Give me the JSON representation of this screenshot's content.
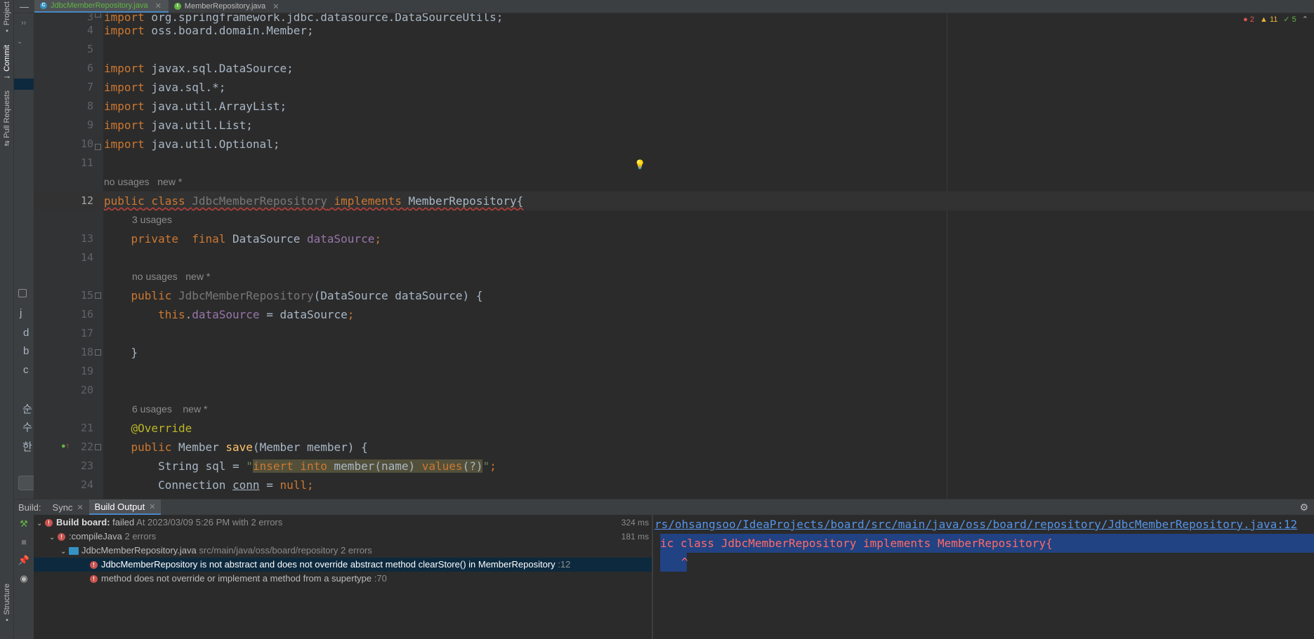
{
  "left_strip": {
    "project_label": "Project",
    "commit_label": "Commit",
    "pull_requests_label": "Pull Requests",
    "structure_label": "Structure"
  },
  "side_panel": {
    "chars": [
      "j",
      "d",
      "b",
      "c",
      "순",
      "수",
      "한"
    ]
  },
  "tabs": [
    {
      "label": "JdbcMemberRepository.java",
      "icon_letter": "C",
      "icon_color": "#3592c4"
    },
    {
      "label": "MemberRepository.java",
      "icon_letter": "I",
      "icon_color": "#62b543"
    }
  ],
  "inspections": {
    "errors": "2",
    "warnings": "11",
    "ok": "5"
  },
  "editor": {
    "lines": {
      "l3": {
        "num": "3",
        "kw": "import",
        "rest": " org.springframework.jdbc.datasource.DataSourceUtils;"
      },
      "l4": {
        "num": "4",
        "kw": "import",
        "rest": " oss.board.domain.Member;"
      },
      "l5": {
        "num": "5"
      },
      "l6": {
        "num": "6",
        "kw": "import",
        "rest": " javax.sql.DataSource;"
      },
      "l7": {
        "num": "7",
        "kw": "import",
        "rest": " java.sql.*;"
      },
      "l8": {
        "num": "8",
        "kw": "import",
        "rest": " java.util.ArrayList;"
      },
      "l9": {
        "num": "9",
        "kw": "import",
        "rest": " java.util.List;"
      },
      "l10": {
        "num": "10",
        "kw": "import",
        "rest": " java.util.Optional;"
      },
      "l11": {
        "num": "11"
      },
      "l12": {
        "num": "12",
        "kw1": "public class ",
        "cls": "JdbcMemberRepository",
        "kw2": " implements ",
        "iface": "MemberRepository{"
      },
      "l13": {
        "num": "13",
        "kw": "private  final ",
        "type": "DataSource ",
        "field": "dataSource",
        "semi": ";"
      },
      "l14": {
        "num": "14"
      },
      "l15": {
        "num": "15",
        "kw": "public ",
        "ctor": "JdbcMemberRepository",
        "rest": "(DataSource dataSource) {"
      },
      "l16": {
        "num": "16",
        "kw": "this",
        "dot": ".",
        "field": "dataSource",
        "rest": " = dataSource",
        "semi": ";"
      },
      "l17": {
        "num": "17"
      },
      "l18": {
        "num": "18",
        "rest": "}"
      },
      "l19": {
        "num": "19"
      },
      "l20": {
        "num": "20"
      },
      "l21": {
        "num": "21",
        "ann": "@Override"
      },
      "l22": {
        "num": "22",
        "kw": "public ",
        "type": "Member ",
        "fn": "save",
        "rest": "(Member member) {"
      },
      "l23": {
        "num": "23",
        "pre": "String sql = ",
        "q1": "\"",
        "s1": "insert into",
        "s2": " member(name) ",
        "s3": "values",
        "s4": "(?)",
        "q2": "\"",
        "semi": ";"
      },
      "l24": {
        "num": "24",
        "pre": "Connection ",
        "var": "conn",
        "mid": " = ",
        "kw": "null",
        "semi": ";"
      }
    },
    "hints": {
      "h12": "no usages   new *",
      "h13": "3 usages",
      "h15": "no usages   new *",
      "h21": "6 usages    new *"
    }
  },
  "build": {
    "title": "Build:",
    "tabs": [
      {
        "label": "Sync"
      },
      {
        "label": "Build Output"
      }
    ],
    "tree": {
      "root": {
        "label": "Build board:",
        "status": " failed",
        "detail": " At 2023/03/09 5:26 PM with 2 errors",
        "time": "324 ms"
      },
      "compile": {
        "label": ":compileJava",
        "count": " 2 errors",
        "time": "181 ms"
      },
      "file": {
        "label": "JdbcMemberRepository.java",
        "path": " src/main/java/oss/board/repository",
        "count": " 2 errors"
      },
      "err1": {
        "label": "JdbcMemberRepository is not abstract and does not override abstract method clearStore() in MemberRepository",
        "loc": " :12"
      },
      "err2": {
        "label": "method does not override or implement a method from a supertype",
        "loc": " :70"
      }
    },
    "console": {
      "path": "rs/ohsangsoo/IdeaProjects/board/src/main/java/oss/board/repository/JdbcMemberRepository.java:12",
      "code": "ic class JdbcMemberRepository implements MemberRepository{",
      "caret": "^"
    }
  }
}
